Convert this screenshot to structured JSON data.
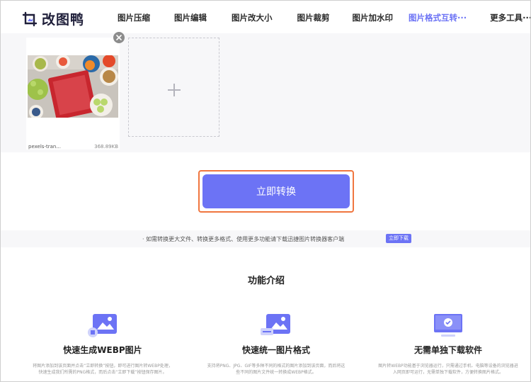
{
  "header": {
    "logo_text": "改图鸭",
    "nav": [
      {
        "label": "图片压缩",
        "active": false
      },
      {
        "label": "图片编辑",
        "active": false
      },
      {
        "label": "图片改大小",
        "active": false
      },
      {
        "label": "图片裁剪",
        "active": false
      },
      {
        "label": "图片加水印",
        "active": false
      },
      {
        "label": "图片格式互转···",
        "active": true
      },
      {
        "label": "更多工具···",
        "active": false
      }
    ]
  },
  "upload": {
    "file_name": "pexels-tran...",
    "file_size": "368.89KB"
  },
  "convert_button": {
    "label": "立即转换"
  },
  "tip": {
    "text": "· 如需转换更大文件、转换更多格式、使用更多功能请下载迅捷图片转换器客户端",
    "link_label": "立即下载"
  },
  "features": {
    "title": "功能介绍",
    "items": [
      {
        "name": "快速生成WEBP图片",
        "desc": "将图片添加到该页面并点击“立即转换”按钮，即可进行图片转WEBP处理，快速生成我们所需的PNG格式，而后点击“立即下载”按钮保存图片。"
      },
      {
        "name": "快速统一图片格式",
        "desc": "支持将PNG、JPG、GIF等多种不同的格式的图片添加到该页面，而后将这些不同的图片文件统一转换成WEBP格式。"
      },
      {
        "name": "无需单独下载软件",
        "desc": "图片转WEBP功能基于浏览器运行，只需通过手机、电脑等设备的浏览器进入网页即可运行，无需单独下载软件，方便转换图片格式。"
      }
    ]
  },
  "colors": {
    "accent": "#6c73f5",
    "highlight": "#f0763f"
  }
}
